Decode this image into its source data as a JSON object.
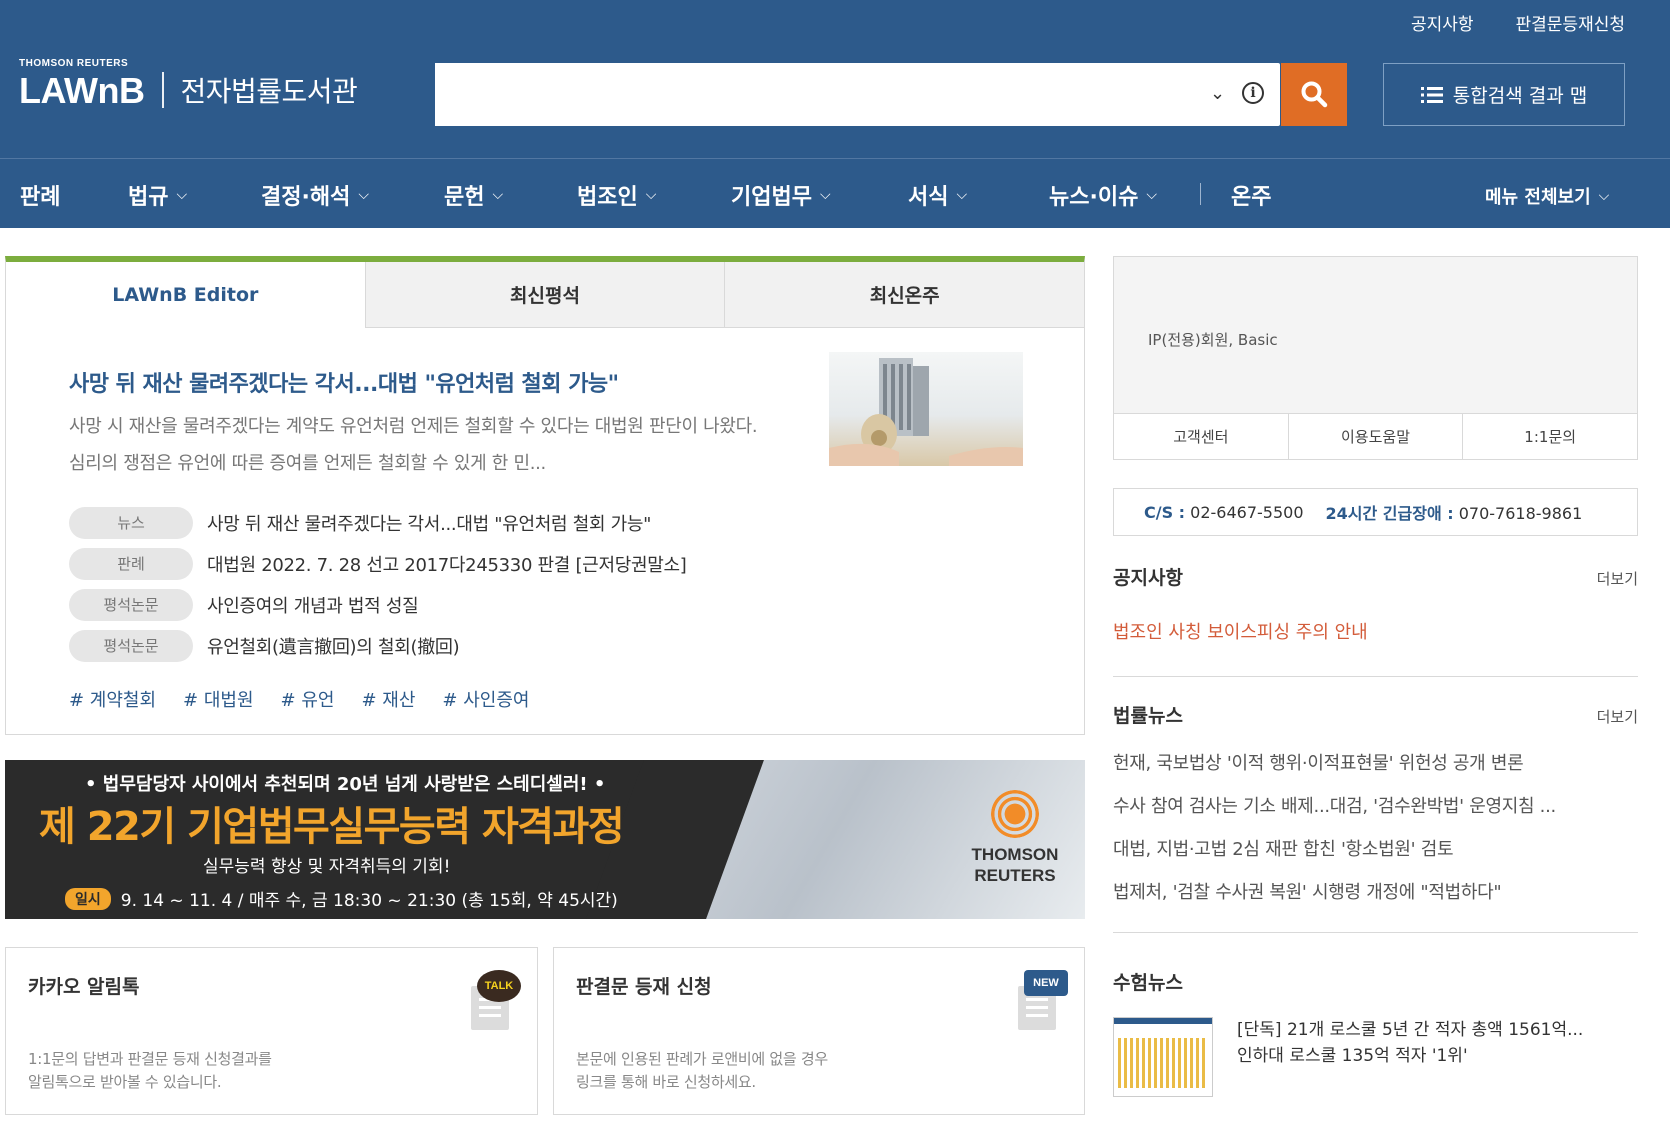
{
  "header": {
    "utility_links": [
      "공지사항",
      "판결문등재신청"
    ],
    "brand_top": "THOMSON REUTERS",
    "brand_logo": "LAWnB",
    "brand_subtitle": "전자법률도서관",
    "search": {
      "value": "",
      "placeholder": ""
    },
    "map_button": "통합검색 결과 맵"
  },
  "nav": {
    "items": [
      {
        "label": "판례"
      },
      {
        "label": "법규"
      },
      {
        "label": "결정·해석"
      },
      {
        "label": "문헌"
      },
      {
        "label": "법조인"
      },
      {
        "label": "기업법무"
      },
      {
        "label": "서식"
      },
      {
        "label": "뉴스·이슈"
      },
      {
        "label": "온주"
      }
    ],
    "all_menu": "메뉴 전체보기"
  },
  "editor": {
    "tabs": [
      "LAWnB Editor",
      "최신평석",
      "최신온주"
    ],
    "title": "사망 뒤 재산 물려주겠다는 각서...대법 \"유언처럼 철회 가능\"",
    "summary": "사망 시 재산을 물려주겠다는 계약도 유언처럼 언제든 철회할 수 있다는 대법원 판단이 나왔다.심리의 쟁점은 유언에 따른 증여를 언제든 철회할 수 있게 한 민...",
    "related": [
      {
        "tag": "뉴스",
        "text": "사망 뒤 재산 물려주겠다는 각서...대법 \"유언처럼 철회 가능\""
      },
      {
        "tag": "판례",
        "text": "대법원 2022. 7. 28 선고 2017다245330 판결 [근저당권말소]"
      },
      {
        "tag": "평석논문",
        "text": "사인증여의 개념과 법적 성질"
      },
      {
        "tag": "평석논문",
        "text": "유언철회(遺言撤回)의 철회(撤回)"
      }
    ],
    "hashtags": [
      "# 계약철회",
      "# 대법원",
      "# 유언",
      "# 재산",
      "# 사인증여"
    ]
  },
  "banner": {
    "line1": "• 법무담당자 사이에서 추천되며 20년 넘게 사랑받은 스테디셀러! •",
    "line2": "제 22기 기업법무실무능력 자격과정",
    "line3": "실무능력 향상 및 자격취득의 기회!",
    "badge": "일시",
    "line4": "9. 14 ~ 11. 4 / 매주 수, 금 18:30 ~ 21:30 (총 15회, 약 45시간)",
    "logo_line1": "THOMSON",
    "logo_line2": "REUTERS"
  },
  "cards": [
    {
      "title": "카카오 알림톡",
      "badge": "TALK",
      "desc1": "1:1문의 답변과 판결문 등재 신청결과를",
      "desc2": "알림톡으로 받아볼 수 있습니다."
    },
    {
      "title": "판결문 등재 신청",
      "badge": "NEW",
      "desc1": "본문에 인용된 판례가 로앤비에 없을 경우",
      "desc2": "링크를 통해 바로 신청하세요."
    }
  ],
  "member": {
    "text": "IP(전용)회원, Basic",
    "links": [
      "고객센터",
      "이용도움말",
      "1:1문의"
    ]
  },
  "cs": {
    "cs_label": "C/S :",
    "cs_phone": "02-6467-5500",
    "emergency_label": "24시간 긴급장애 :",
    "emergency_phone": "070-7618-9861"
  },
  "notice": {
    "title": "공지사항",
    "more": "더보기",
    "item": "법조인 사칭 보이스피싱 주의 안내"
  },
  "law_news": {
    "title": "법률뉴스",
    "more": "더보기",
    "items": [
      "헌재, 국보법상 '이적 행위·이적표현물' 위헌성 공개 변론",
      "수사 참여 검사는 기소 배제...대검, '검수완박법' 운영지침 ...",
      "대법, 지법·고법 2심 재판 합친 '항소법원' 검토",
      "법제처, '검찰 수사권 복원' 시행령 개정에 \"적법하다\""
    ]
  },
  "exam_news": {
    "title": "수험뉴스",
    "line1": "[단독] 21개 로스쿨 5년 간 적자 총액 1561억...",
    "line2": "인하대 로스쿨 135억 적자 '1위'"
  },
  "colors": {
    "header_bg": "#2d5a8b",
    "search_button": "#e06d25",
    "card_top_border": "#7cad3e",
    "notice_red": "#d35c3a",
    "banner_orange": "#f2a52c"
  }
}
